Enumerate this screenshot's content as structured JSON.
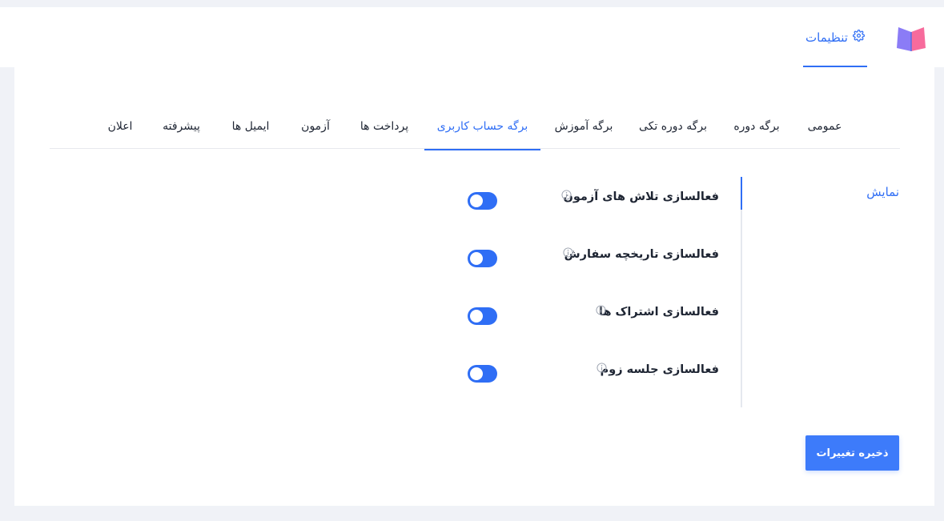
{
  "header": {
    "logo_icon": "book-icon",
    "settings_tab": {
      "label": "تنظیمات",
      "icon": "gear-icon"
    }
  },
  "tabs": [
    {
      "label": "عمومی",
      "active": false
    },
    {
      "label": "برگه دوره",
      "active": false
    },
    {
      "label": "برگه دوره تکی",
      "active": false
    },
    {
      "label": "برگه آموزش",
      "active": false
    },
    {
      "label": "برگه حساب کاربری",
      "active": true
    },
    {
      "label": "پرداخت ها",
      "active": false
    },
    {
      "label": "آزمون",
      "active": false
    },
    {
      "label": "ایمیل ها",
      "active": false
    },
    {
      "label": "پیشرفته",
      "active": false
    },
    {
      "label": "اعلان",
      "active": false
    }
  ],
  "section": {
    "label": "نمایش"
  },
  "options": [
    {
      "label": "فعالسازی تلاش های آزمون",
      "info_icon": "info-icon",
      "enabled": false
    },
    {
      "label": "فعالسازی تاریخچه سفارش",
      "info_icon": "info-icon",
      "enabled": false
    },
    {
      "label": "فعالسازی اشتراک ها",
      "info_icon": "info-icon",
      "enabled": false
    },
    {
      "label": "فعالسازی جلسه زوم",
      "info_icon": "info-icon",
      "enabled": false
    }
  ],
  "save_button": {
    "label": "ذخیره تغییرات"
  },
  "colors": {
    "accent": "#2f6ef5",
    "button": "#3d7bfa",
    "background": "#f0f2f7",
    "text": "#1e2533"
  }
}
